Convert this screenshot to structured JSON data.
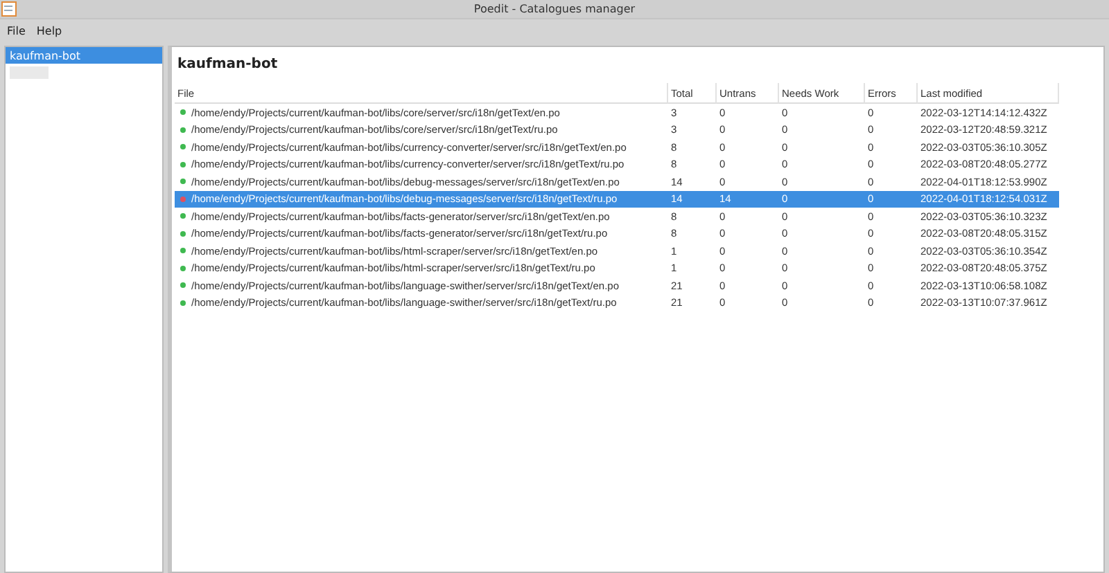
{
  "window": {
    "title": "Poedit - Catalogues manager"
  },
  "menu": [
    "File",
    "Help"
  ],
  "sidebar": {
    "items": [
      {
        "label": "kaufman-bot",
        "selected": true
      },
      {
        "kind": "redacted",
        "selected": false
      }
    ]
  },
  "project": {
    "title": "kaufman-bot"
  },
  "table": {
    "columns": [
      "File",
      "Total",
      "Untrans",
      "Needs Work",
      "Errors",
      "Last modified"
    ],
    "rows": [
      {
        "color": "#3fb950",
        "selected": false,
        "cells": [
          "/home/endy/Projects/current/kaufman-bot/libs/core/server/src/i18n/getText/en.po",
          "3",
          "0",
          "0",
          "0",
          "2022-03-12T14:14:12.432Z"
        ]
      },
      {
        "color": "#3fb950",
        "selected": false,
        "cells": [
          "/home/endy/Projects/current/kaufman-bot/libs/core/server/src/i18n/getText/ru.po",
          "3",
          "0",
          "0",
          "0",
          "2022-03-12T20:48:59.321Z"
        ]
      },
      {
        "color": "#3fb950",
        "selected": false,
        "cells": [
          "/home/endy/Projects/current/kaufman-bot/libs/currency-converter/server/src/i18n/getText/en.po",
          "8",
          "0",
          "0",
          "0",
          "2022-03-03T05:36:10.305Z"
        ]
      },
      {
        "color": "#3fb950",
        "selected": false,
        "cells": [
          "/home/endy/Projects/current/kaufman-bot/libs/currency-converter/server/src/i18n/getText/ru.po",
          "8",
          "0",
          "0",
          "0",
          "2022-03-08T20:48:05.277Z"
        ]
      },
      {
        "color": "#3fb950",
        "selected": false,
        "cells": [
          "/home/endy/Projects/current/kaufman-bot/libs/debug-messages/server/src/i18n/getText/en.po",
          "14",
          "0",
          "0",
          "0",
          "2022-04-01T18:12:53.990Z"
        ]
      },
      {
        "color": "#e05060",
        "selected": true,
        "cells": [
          "/home/endy/Projects/current/kaufman-bot/libs/debug-messages/server/src/i18n/getText/ru.po",
          "14",
          "14",
          "0",
          "0",
          "2022-04-01T18:12:54.031Z"
        ]
      },
      {
        "color": "#3fb950",
        "selected": false,
        "cells": [
          "/home/endy/Projects/current/kaufman-bot/libs/facts-generator/server/src/i18n/getText/en.po",
          "8",
          "0",
          "0",
          "0",
          "2022-03-03T05:36:10.323Z"
        ]
      },
      {
        "color": "#3fb950",
        "selected": false,
        "cells": [
          "/home/endy/Projects/current/kaufman-bot/libs/facts-generator/server/src/i18n/getText/ru.po",
          "8",
          "0",
          "0",
          "0",
          "2022-03-08T20:48:05.315Z"
        ]
      },
      {
        "color": "#3fb950",
        "selected": false,
        "cells": [
          "/home/endy/Projects/current/kaufman-bot/libs/html-scraper/server/src/i18n/getText/en.po",
          "1",
          "0",
          "0",
          "0",
          "2022-03-03T05:36:10.354Z"
        ]
      },
      {
        "color": "#3fb950",
        "selected": false,
        "cells": [
          "/home/endy/Projects/current/kaufman-bot/libs/html-scraper/server/src/i18n/getText/ru.po",
          "1",
          "0",
          "0",
          "0",
          "2022-03-08T20:48:05.375Z"
        ]
      },
      {
        "color": "#3fb950",
        "selected": false,
        "cells": [
          "/home/endy/Projects/current/kaufman-bot/libs/language-swither/server/src/i18n/getText/en.po",
          "21",
          "0",
          "0",
          "0",
          "2022-03-13T10:06:58.108Z"
        ]
      },
      {
        "color": "#3fb950",
        "selected": false,
        "cells": [
          "/home/endy/Projects/current/kaufman-bot/libs/language-swither/server/src/i18n/getText/ru.po",
          "21",
          "0",
          "0",
          "0",
          "2022-03-13T10:07:37.961Z"
        ]
      }
    ]
  }
}
